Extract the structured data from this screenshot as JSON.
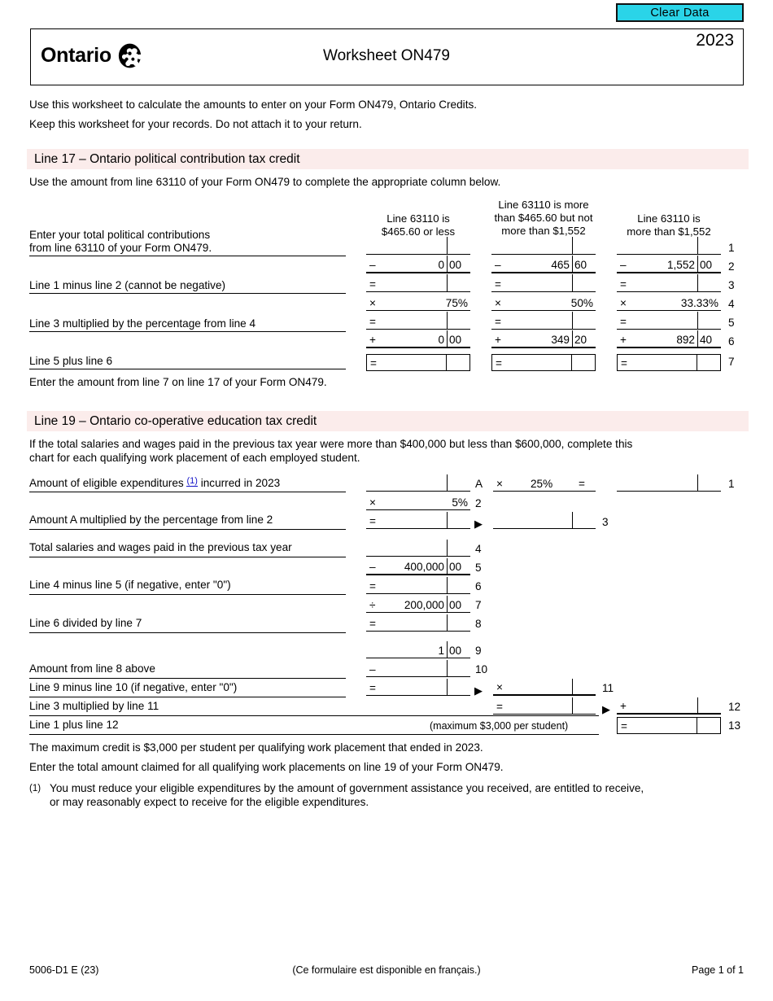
{
  "clear_data_button": "Clear Data",
  "header": {
    "province": "Ontario",
    "title": "Worksheet ON479",
    "year": "2023"
  },
  "intro": {
    "line1": "Use this worksheet to calculate the amounts to enter on your Form ON479, Ontario Credits.",
    "line2": "Keep this worksheet for your records. Do not attach it to your return."
  },
  "section17": {
    "heading": "Line 17 – Ontario political contribution tax credit",
    "instruction": "Use the amount from line 63110 of your Form ON479 to complete the appropriate column below.",
    "column_headers": [
      "Line 63110 is\n$465.60 or less",
      "Line 63110 is more\nthan $465.60 but not\nmore than $1,552",
      "Line 63110 is\nmore than $1,552"
    ],
    "col_head_a_l1": "Line 63110 is",
    "col_head_a_l2": "$465.60 or less",
    "col_head_b_l1": "Line 63110 is more",
    "col_head_b_l2": "than $465.60 but not",
    "col_head_b_l3": "more than $1,552",
    "col_head_c_l1": "Line 63110 is",
    "col_head_c_l2": "more than $1,552",
    "labels": {
      "row1": "Enter your total political contributions",
      "row1b": "from line 63110 of your Form ON479.",
      "row3": "Line 1 minus line 2 (cannot be negative)",
      "row5": "Line 3 multiplied by the percentage from line 4",
      "row7": "Line 5 plus line 6"
    },
    "rows": [
      {
        "n": "1",
        "op": "",
        "a_d": "",
        "a_c": "",
        "b_d": "",
        "b_c": "",
        "c_d": "",
        "c_c": ""
      },
      {
        "n": "2",
        "op": "–",
        "a_d": "0",
        "a_c": "00",
        "b_d": "465",
        "b_c": "60",
        "c_d": "1,552",
        "c_c": "00"
      },
      {
        "n": "3",
        "op": "=",
        "a_d": "",
        "a_c": "",
        "b_d": "",
        "b_c": "",
        "c_d": "",
        "c_c": ""
      },
      {
        "n": "4",
        "op": "×",
        "a_pct": "75%",
        "b_pct": "50%",
        "c_pct": "33.33%"
      },
      {
        "n": "5",
        "op": "=",
        "a_d": "",
        "a_c": "",
        "b_d": "",
        "b_c": "",
        "c_d": "",
        "c_c": ""
      },
      {
        "n": "6",
        "op": "+",
        "a_d": "0",
        "a_c": "00",
        "b_d": "349",
        "b_c": "20",
        "c_d": "892",
        "c_c": "40"
      },
      {
        "n": "7",
        "op": "=",
        "a_d": "",
        "a_c": "",
        "b_d": "",
        "b_c": "",
        "c_d": "",
        "c_c": ""
      }
    ],
    "closing": "Enter the amount from line 7 on line 17 of your Form ON479."
  },
  "section19": {
    "heading": "Line 19 – Ontario co-operative education tax credit",
    "instruction_l1": "If the total salaries and wages paid in the previous tax year were more than $400,000 but less than $600,000, complete this",
    "instruction_l2": "chart for each qualifying work placement of each employed student.",
    "labels": {
      "r1_pre": "Amount of eligible expenditures",
      "r1_note": "(1)",
      "r1_post": "incurred in 2023",
      "r3": "Amount A multiplied by the percentage from line 2",
      "r4": "Total salaries and wages paid in the previous tax year",
      "r6": "Line 4 minus line 5 (if negative, enter \"0\")",
      "r8": "Line 6 divided by line 7",
      "r10": "Amount from line 8 above",
      "r11": "Line 9 minus line 10 (if negative, enter \"0\")",
      "r12": "Line 3 multiplied by line 11",
      "r13": "Line 1 plus line 12"
    },
    "marker_a": "A",
    "op_times_1": "×",
    "pct_25": "25%",
    "eq_1": "=",
    "rownum_1": "1",
    "op_times_2": "×",
    "pct_5": "5%",
    "rownum_2": "2",
    "op_eq_3": "=",
    "rownum_3": "3",
    "rownum_4": "4",
    "op_minus_5": "–",
    "val_5_d": "400,000",
    "val_5_c": "00",
    "rownum_5": "5",
    "op_eq_6": "=",
    "rownum_6": "6",
    "op_div_7": "÷",
    "val_7_d": "200,000",
    "val_7_c": "00",
    "rownum_7": "7",
    "op_eq_8": "=",
    "rownum_8": "8",
    "val_9_d": "1",
    "val_9_c": "00",
    "rownum_9": "9",
    "op_minus_10": "–",
    "rownum_10": "10",
    "op_eq_11": "=",
    "op_times_11": "×",
    "rownum_11": "11",
    "op_eq_12": "=",
    "op_plus_12": "+",
    "rownum_12": "12",
    "max_note": "(maximum $3,000 per student)",
    "op_eq_13": "=",
    "rownum_13": "13",
    "closing_l1": "The maximum credit is $3,000 per student per qualifying work placement that ended in 2023.",
    "closing_l2": "Enter the total amount claimed for all qualifying work placements on line 19 of your Form ON479.",
    "footnote_marker": "(1)",
    "footnote_l1": "You must reduce your eligible expenditures by the amount of government assistance you received, are entitled to receive,",
    "footnote_l2": "or may reasonably expect to receive for the eligible expenditures."
  },
  "footer": {
    "code": "5006-D1 E (23)",
    "french": "(Ce formulaire est disponible en français.)",
    "page": "Page 1 of 1"
  },
  "colors": {
    "section_bar": "#fbeceb",
    "clear_button": "#2ad4e8",
    "footnote_link": "#1414c8"
  }
}
